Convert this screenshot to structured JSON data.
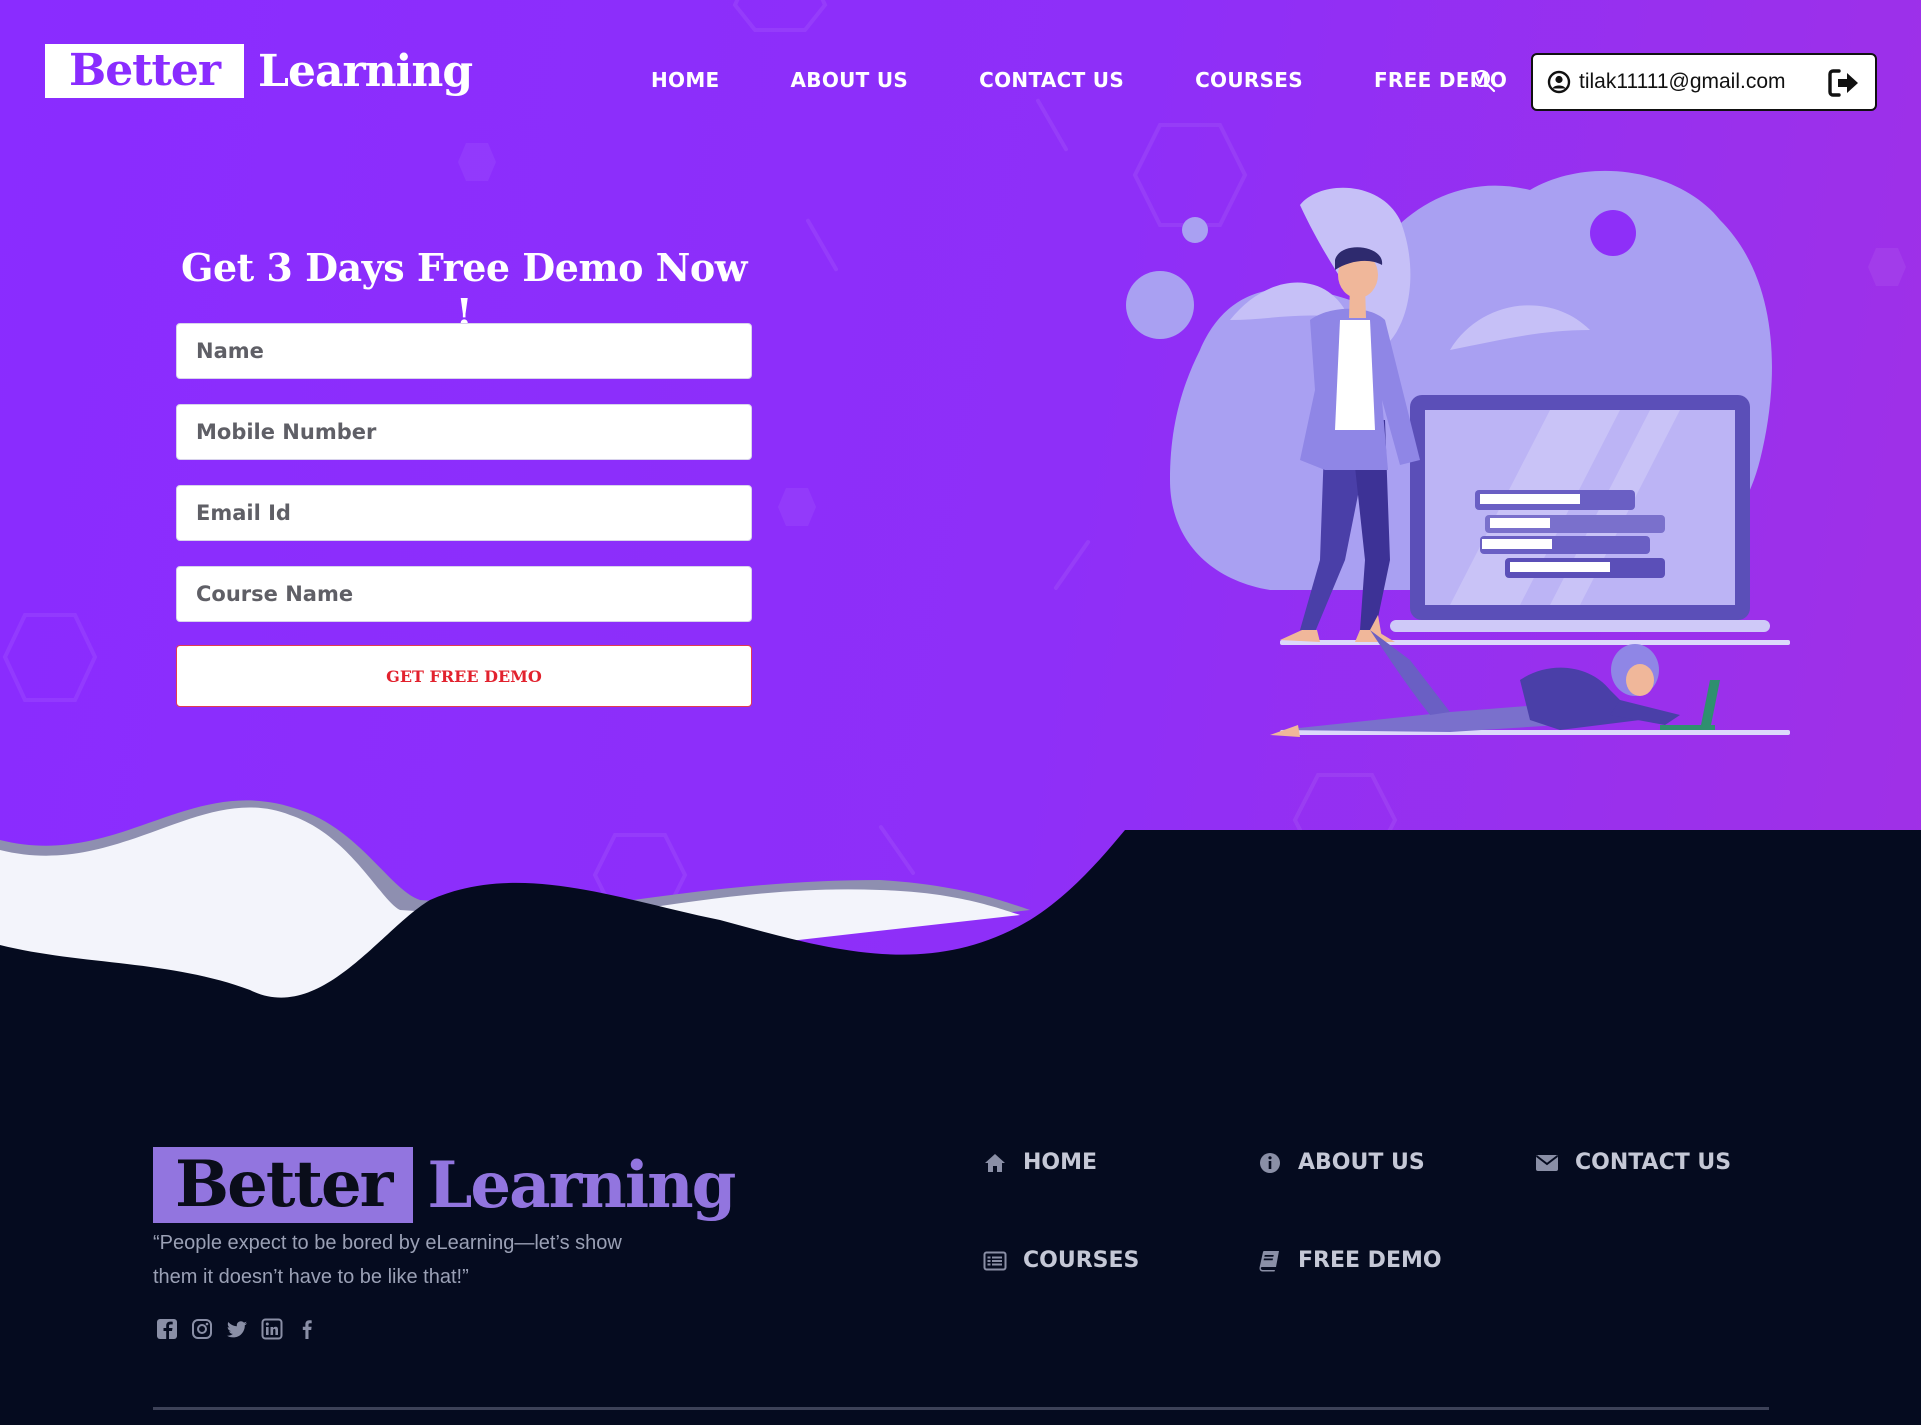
{
  "brand": {
    "part1": "Better",
    "part2": "Learning"
  },
  "nav": {
    "items": [
      {
        "label": "HOME"
      },
      {
        "label": "ABOUT US"
      },
      {
        "label": "CONTACT US"
      },
      {
        "label": "COURSES"
      },
      {
        "label": "FREE DEMO"
      }
    ],
    "search_icon": "search-icon"
  },
  "account": {
    "email": "tilak11111@gmail.com",
    "user_icon": "user-circle-icon",
    "logout_icon": "sign-out-icon"
  },
  "demo_form": {
    "title": "Get 3 Days Free Demo Now !",
    "fields": {
      "name": {
        "placeholder": "Name"
      },
      "mobile": {
        "placeholder": "Mobile Number"
      },
      "email": {
        "placeholder": "Email Id"
      },
      "course": {
        "placeholder": "Course Name"
      }
    },
    "submit_label": "GET FREE DEMO"
  },
  "footer": {
    "brand": {
      "part1": "Better",
      "part2": "Learning"
    },
    "quote": "“People expect to be bored by eLearning—let’s show them it doesn’t have to be like that!”",
    "social": [
      "facebook-square-icon",
      "instagram-icon",
      "twitter-icon",
      "linkedin-icon",
      "facebook-f-icon"
    ],
    "links": [
      {
        "label": "HOME",
        "icon": "home-icon"
      },
      {
        "label": "ABOUT US",
        "icon": "info-circle-icon"
      },
      {
        "label": "CONTACT US",
        "icon": "envelope-icon"
      },
      {
        "label": "COURSES",
        "icon": "list-alt-icon"
      },
      {
        "label": "FREE DEMO",
        "icon": "book-icon"
      }
    ]
  },
  "colors": {
    "hero_purple": "#8a2cff",
    "footer_bg": "#050b1f",
    "footer_accent": "#9275df",
    "button_red": "#e2222e"
  }
}
